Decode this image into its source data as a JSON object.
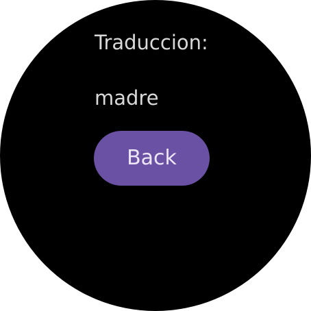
{
  "screen": {
    "heading": "Traduccion:",
    "translation": "madre",
    "back_label": "Back"
  },
  "colors": {
    "background": "#000000",
    "text": "#d9d9d9",
    "button": "#6a51a3",
    "button_text": "#ede6f7"
  }
}
